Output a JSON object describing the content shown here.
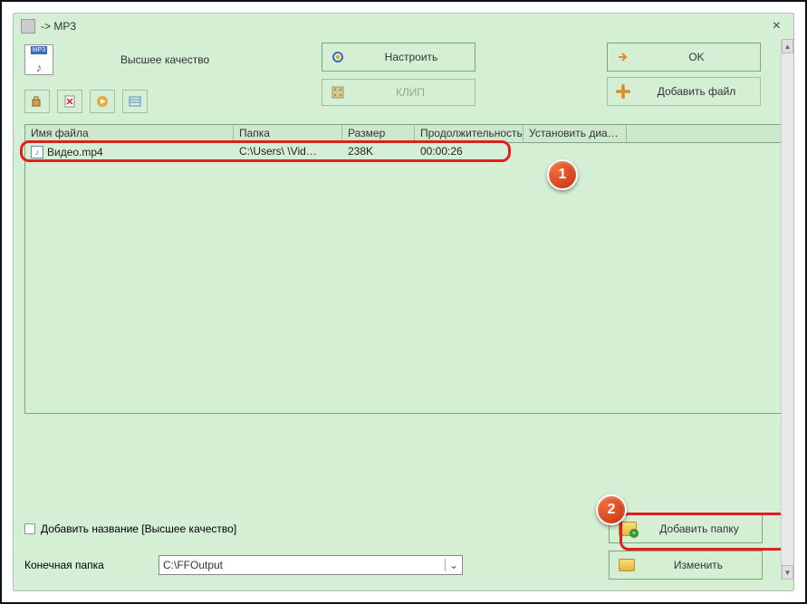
{
  "window": {
    "title": "-> MP3",
    "close_label": "×"
  },
  "top": {
    "mp3_badge": "MP3",
    "quality_label": "Высшее качество",
    "configure_label": "Настроить",
    "ok_label": "OK",
    "clip_label": "КЛИП",
    "add_file_label": "Добавить файл"
  },
  "table": {
    "headers": {
      "filename": "Имя файла",
      "folder": "Папка",
      "size": "Размер",
      "duration": "Продолжительность",
      "set_range": "Установить диапа…"
    },
    "rows": [
      {
        "filename": "Видео.mp4",
        "folder": "C:\\Users\\        \\Vid…",
        "size": "238K",
        "duration": "00:00:26"
      }
    ]
  },
  "badges": {
    "one": "1",
    "two": "2"
  },
  "bottom": {
    "add_title_label": "Добавить название [Высшее качество]",
    "add_folder_label": "Добавить папку",
    "output_folder_label": "Конечная папка",
    "output_folder_value": "C:\\FFOutput",
    "change_label": "Изменить"
  }
}
